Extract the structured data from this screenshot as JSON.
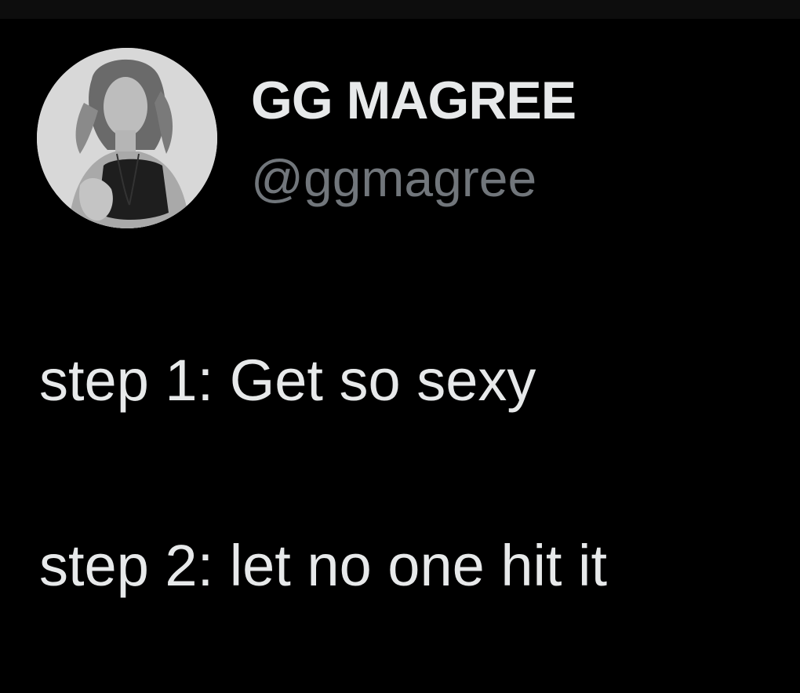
{
  "tweet": {
    "author": {
      "display_name": "GG MAGREE",
      "handle": "@ggmagree",
      "avatar_icon": "profile-photo"
    },
    "text_lines": [
      "step 1: Get so sexy",
      "step 2: let no one hit it"
    ]
  },
  "colors": {
    "background": "#000000",
    "primary_text": "#e7e9ea",
    "secondary_text": "#71767b"
  }
}
